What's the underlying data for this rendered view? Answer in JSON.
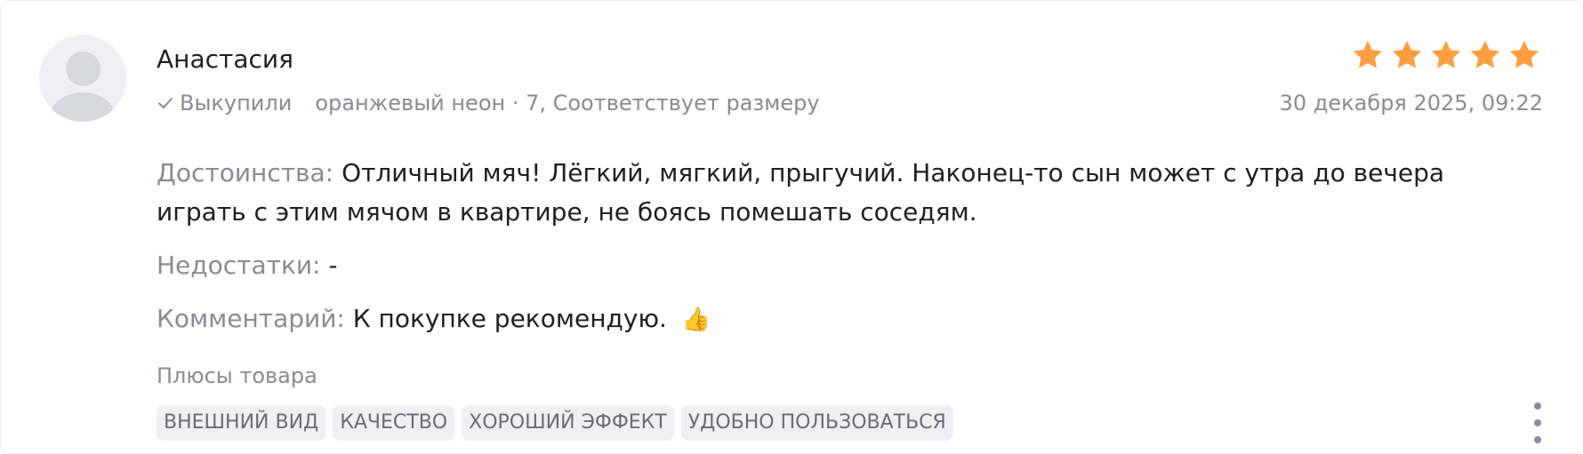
{
  "review": {
    "author": "Анастасия",
    "bought_label": "Выкупили",
    "variant": "оранжевый неон · 7, Соответствует размеру",
    "rating": 5,
    "date": "30 декабря 2025, 09:22",
    "pros_label": "Достоинства:",
    "pros_text": "Отличный мяч! Лёгкий, мягкий, прыгучий. Наконец-то сын может с утра до вечера играть с этим мячом в квартире, не боясь помешать соседям.",
    "cons_label": "Недостатки:",
    "cons_text": "-",
    "comment_label": "Комментарий:",
    "comment_text": "К покупке рекомендую.",
    "comment_emoji": "👍",
    "tags_title": "Плюсы товара",
    "tags": [
      "ВНЕШНИЙ ВИД",
      "КАЧЕСТВО",
      "ХОРОШИЙ ЭФФЕКТ",
      "УДОБНО ПОЛЬЗОВАТЬСЯ"
    ]
  },
  "colors": {
    "star": "#ff9f3f",
    "muted_text": "#8a8a99",
    "tag_bg": "#f0f0f4"
  },
  "icons": {
    "avatar": "user-placeholder-icon",
    "bought": "check-icon",
    "rating": "star-icon",
    "more": "more-vertical-icon"
  }
}
